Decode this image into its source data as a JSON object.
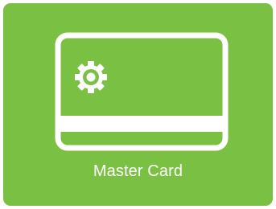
{
  "tile": {
    "label": "Master Card",
    "icon": "credit-card-gear-icon",
    "background_color": "#7ac143",
    "foreground_color": "#ffffff"
  }
}
